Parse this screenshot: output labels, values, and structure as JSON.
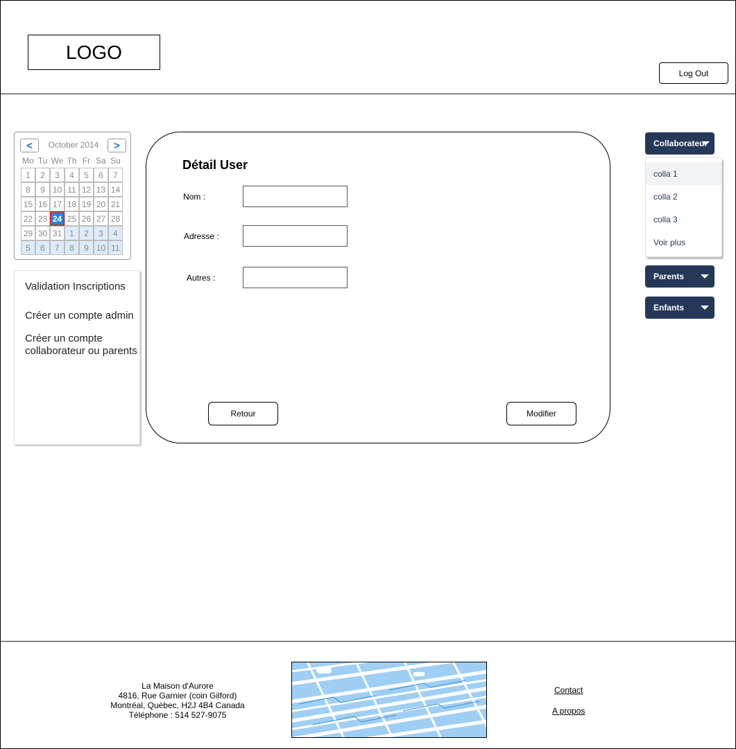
{
  "header": {
    "logo_text": "LOGO",
    "logout_label": "Log Out"
  },
  "calendar": {
    "prev_label": "<",
    "next_label": ">",
    "month_label": "October 2014",
    "weekdays": [
      "Mo",
      "Tu",
      "We",
      "Th",
      "Fr",
      "Sa",
      "Su"
    ],
    "weeks": [
      [
        "1",
        "2",
        "3",
        "4",
        "5",
        "6",
        "7"
      ],
      [
        "8",
        "9",
        "10",
        "11",
        "12",
        "13",
        "14"
      ],
      [
        "15",
        "16",
        "17",
        "18",
        "19",
        "20",
        "21"
      ],
      [
        "22",
        "23",
        "24",
        "25",
        "26",
        "27",
        "28"
      ],
      [
        "29",
        "30",
        "31",
        "1",
        "2",
        "3",
        "4"
      ],
      [
        "5",
        "6",
        "7",
        "8",
        "9",
        "10",
        "11"
      ]
    ],
    "selected_day": "24",
    "colors": {
      "selected_bg": "#1e88e5",
      "selected_border": "#d32f2f",
      "other_month_bg": "#dcebf7"
    }
  },
  "left_menu": {
    "items": [
      {
        "label": "Validation Inscriptions"
      },
      {
        "label": "Créer un compte admin"
      },
      {
        "label": "Créer un compte collaborateur ou parents"
      }
    ]
  },
  "main": {
    "title": "Détail User",
    "fields": [
      {
        "label": "Nom :",
        "value": ""
      },
      {
        "label": "Adresse :",
        "value": ""
      },
      {
        "label": "Autres :",
        "value": ""
      }
    ],
    "back_label": "Retour",
    "edit_label": "Modifier"
  },
  "right_menu": {
    "collaborateur": {
      "label": "Collaborateur",
      "items": [
        "colla 1",
        "colla 2",
        "colla 3",
        "Voir plus"
      ]
    },
    "parents": {
      "label": "Parents"
    },
    "enfants": {
      "label": "Enfants"
    },
    "colors": {
      "button_bg": "#253858",
      "item_text": "#253858"
    }
  },
  "footer": {
    "address_lines": [
      "La Maison d'Aurore",
      "4816, Rue Garnier (coin Gilford)",
      "Montréal, Québec, H2J 4B4 Canada",
      "Téléphone : 514 527-9075"
    ],
    "contact_label": "Contact",
    "about_label": "A propos"
  }
}
